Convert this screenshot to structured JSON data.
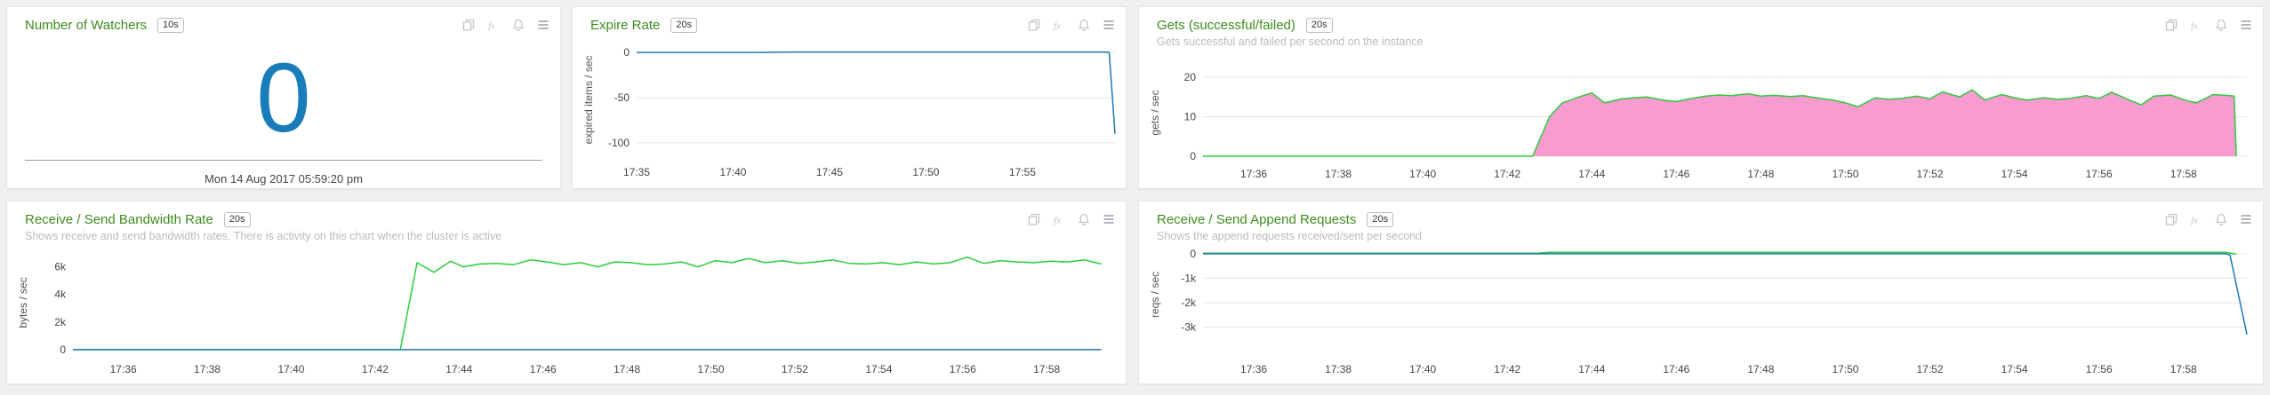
{
  "colors": {
    "title": "#3d8b1f",
    "blue_line": "#1f77b4",
    "green_line": "#2bcb3a",
    "pink_fill": "#f79bd0",
    "value": "#1a7dbb",
    "grid": "#e6e6e6"
  },
  "icons": [
    "copy-icon",
    "fx-icon",
    "bell-icon",
    "menu-icon"
  ],
  "panels": {
    "watchers": {
      "title": "Number of Watchers",
      "interval": "10s",
      "value": "0",
      "timestamp": "Mon 14 Aug 2017 05:59:20 pm"
    },
    "expire": {
      "title": "Expire Rate",
      "interval": "20s"
    },
    "gets": {
      "title": "Gets (successful/failed)",
      "interval": "20s",
      "subtitle": "Gets successful and failed per second on the instance"
    },
    "bandwidth": {
      "title": "Receive / Send Bandwidth Rate",
      "interval": "20s",
      "subtitle": "Shows receive and send bandwidth rates. There is activity on this chart when the cluster is active"
    },
    "append": {
      "title": "Receive / Send Append Requests",
      "interval": "20s",
      "subtitle": "Shows the append requests received/sent per second"
    }
  },
  "chart_data": [
    {
      "id": "expire",
      "type": "line",
      "ylabel": "expired items / sec",
      "ylim": [
        -110,
        5
      ],
      "yticks": [
        0,
        -50,
        -100
      ],
      "ytick_labels": [
        "0",
        "-50",
        "-100"
      ],
      "xlim": [
        5.0,
        29.8
      ],
      "xtick_values": [
        5,
        10,
        15,
        20,
        25
      ],
      "xtick_labels": [
        "17:35",
        "17:40",
        "17:45",
        "17:50",
        "17:55"
      ],
      "grid": true,
      "series": [
        {
          "color": "#1f77b4",
          "x": [
            5,
            11,
            13,
            15,
            17,
            19,
            21,
            23,
            25,
            27,
            29.3,
            29.5,
            29.8
          ],
          "y": [
            0,
            0,
            0.5,
            0.5,
            0.5,
            0.5,
            0.5,
            0.5,
            0.5,
            0.5,
            0.5,
            0,
            -90
          ]
        }
      ]
    },
    {
      "id": "gets",
      "type": "area",
      "ylabel": "gets / sec",
      "ylim": [
        0,
        22
      ],
      "yticks": [
        0,
        10,
        20
      ],
      "ytick_labels": [
        "0",
        "10",
        "20"
      ],
      "xlim": [
        34.8,
        59.5
      ],
      "xtick_values": [
        36,
        38,
        40,
        42,
        44,
        46,
        48,
        50,
        52,
        54,
        56,
        58
      ],
      "xtick_labels": [
        "17:36",
        "17:38",
        "17:40",
        "17:42",
        "17:44",
        "17:46",
        "17:48",
        "17:50",
        "17:52",
        "17:54",
        "17:56",
        "17:58"
      ],
      "grid": true,
      "series": [
        {
          "color": "#2bcb3a",
          "fill": "#f79bd0",
          "x": [
            34.8,
            42.6,
            43.0,
            43.3,
            43.7,
            44.0,
            44.3,
            44.7,
            45.0,
            45.3,
            45.7,
            46.0,
            46.3,
            46.7,
            47.0,
            47.3,
            47.7,
            48.0,
            48.3,
            48.7,
            49.0,
            49.3,
            49.7,
            50.0,
            50.3,
            50.7,
            51.0,
            51.3,
            51.7,
            52.0,
            52.3,
            52.7,
            53.0,
            53.3,
            53.7,
            54.0,
            54.3,
            54.7,
            55.0,
            55.3,
            55.7,
            56.0,
            56.3,
            56.7,
            57.0,
            57.3,
            57.7,
            58.0,
            58.3,
            58.7,
            59.0,
            59.2,
            59.25
          ],
          "y": [
            0,
            0,
            10,
            13.5,
            15,
            16,
            13.5,
            14.5,
            14.8,
            15,
            14.2,
            13.8,
            14.5,
            15.2,
            15.5,
            15.3,
            15.8,
            15.2,
            15.4,
            15.1,
            15.3,
            14.8,
            14.2,
            13.5,
            12.5,
            14.8,
            14.4,
            14.6,
            15.2,
            14.5,
            16.3,
            15.0,
            16.8,
            14.2,
            15.6,
            14.8,
            14.2,
            14.8,
            14.4,
            14.6,
            15.3,
            14.6,
            16.2,
            14.3,
            13.0,
            15.2,
            15.5,
            14.3,
            13.5,
            15.6,
            15.4,
            15.2,
            0
          ]
        }
      ]
    },
    {
      "id": "bandwidth",
      "type": "line",
      "ylabel": "bytes / sec",
      "ylim": [
        -200,
        7000
      ],
      "yticks": [
        0,
        2000,
        4000,
        6000
      ],
      "ytick_labels": [
        "0",
        "2k",
        "4k",
        "6k"
      ],
      "xlim": [
        34.8,
        59.5
      ],
      "xtick_values": [
        36,
        38,
        40,
        42,
        44,
        46,
        48,
        50,
        52,
        54,
        56,
        58
      ],
      "xtick_labels": [
        "17:36",
        "17:38",
        "17:40",
        "17:42",
        "17:44",
        "17:46",
        "17:48",
        "17:50",
        "17:52",
        "17:54",
        "17:56",
        "17:58"
      ],
      "grid": false,
      "series": [
        {
          "color": "#2bcb3a",
          "x": [
            34.8,
            42.6,
            43.0,
            43.4,
            43.8,
            44.1,
            44.5,
            44.9,
            45.3,
            45.7,
            46.1,
            46.5,
            46.9,
            47.3,
            47.7,
            48.1,
            48.5,
            48.9,
            49.3,
            49.7,
            50.1,
            50.5,
            50.9,
            51.3,
            51.7,
            52.1,
            52.5,
            52.9,
            53.3,
            53.7,
            54.1,
            54.5,
            54.9,
            55.3,
            55.7,
            56.1,
            56.5,
            56.9,
            57.3,
            57.7,
            58.1,
            58.5,
            58.9,
            59.3
          ],
          "y": [
            0,
            0,
            6300,
            5600,
            6400,
            6000,
            6200,
            6250,
            6150,
            6500,
            6350,
            6150,
            6300,
            6000,
            6350,
            6300,
            6150,
            6200,
            6350,
            6000,
            6450,
            6300,
            6600,
            6300,
            6450,
            6250,
            6350,
            6500,
            6250,
            6200,
            6300,
            6150,
            6350,
            6200,
            6300,
            6700,
            6250,
            6450,
            6350,
            6300,
            6400,
            6350,
            6500,
            6200
          ]
        },
        {
          "color": "#1f77b4",
          "x": [
            34.8,
            59.3
          ],
          "y": [
            0,
            0
          ]
        }
      ]
    },
    {
      "id": "append",
      "type": "line",
      "ylabel": "reqs / sec",
      "ylim": [
        -3600,
        250
      ],
      "yticks": [
        0,
        -1000,
        -2000,
        -3000
      ],
      "ytick_labels": [
        "0",
        "-1k",
        "-2k",
        "-3k"
      ],
      "xlim": [
        34.8,
        59.5
      ],
      "xtick_values": [
        36,
        38,
        40,
        42,
        44,
        46,
        48,
        50,
        52,
        54,
        56,
        58
      ],
      "xtick_labels": [
        "17:36",
        "17:38",
        "17:40",
        "17:42",
        "17:44",
        "17:46",
        "17:48",
        "17:50",
        "17:52",
        "17:54",
        "17:56",
        "17:58"
      ],
      "grid": true,
      "series": [
        {
          "color": "#2bcb3a",
          "x": [
            34.8,
            42.7,
            43.0,
            59.0,
            59.25
          ],
          "y": [
            20,
            20,
            60,
            60,
            -20
          ]
        },
        {
          "color": "#1f77b4",
          "x": [
            34.8,
            59.0,
            59.1,
            59.5
          ],
          "y": [
            0,
            0,
            -50,
            -3300
          ]
        }
      ]
    }
  ]
}
